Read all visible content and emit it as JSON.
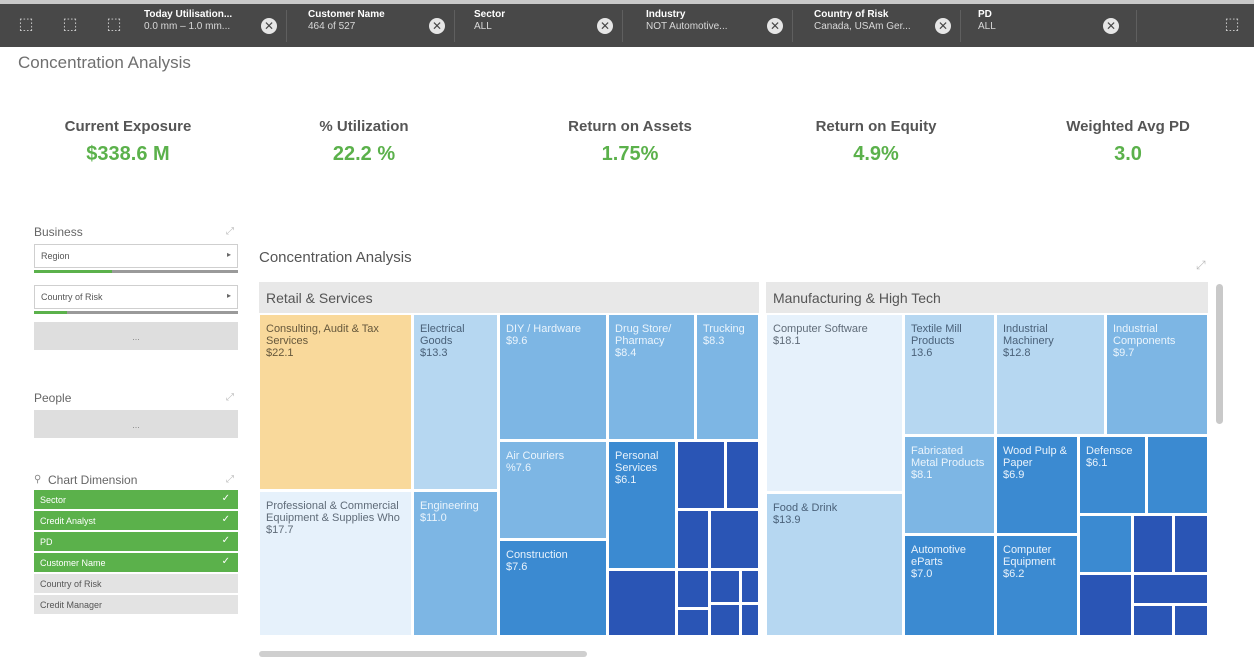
{
  "filters": [
    {
      "title": "Today Utilisation...",
      "value": "0.0 mm – 1.0 mm..."
    },
    {
      "title": "Customer Name",
      "value": "464 of 527"
    },
    {
      "title": "Sector",
      "value": "ALL"
    },
    {
      "title": "Industry",
      "value": "NOT Automotive..."
    },
    {
      "title": "Country of Risk",
      "value": "Canada, USAm Ger..."
    },
    {
      "title": "PD",
      "value": "ALL"
    }
  ],
  "app_title": "Concentration Analysis",
  "kpis": [
    {
      "label": "Current Exposure",
      "value": "$338.6 M"
    },
    {
      "label": "% Utilization",
      "value": "22.2 %"
    },
    {
      "label": "Return on Assets",
      "value": "1.75%"
    },
    {
      "label": "Return on Equity",
      "value": "4.9%"
    },
    {
      "label": "Weighted Avg PD",
      "value": "3.0"
    }
  ],
  "business": {
    "title": "Business",
    "items": [
      "Region",
      "Country of Risk"
    ],
    "more": "..."
  },
  "people": {
    "title": "People",
    "more": "..."
  },
  "chart_dimension": {
    "title": "Chart Dimension",
    "items": [
      {
        "label": "Sector",
        "selected": true
      },
      {
        "label": "Credit Analyst",
        "selected": true
      },
      {
        "label": "PD",
        "selected": true
      },
      {
        "label": "Customer Name",
        "selected": true
      },
      {
        "label": "Country of Risk",
        "selected": false
      },
      {
        "label": "Credit Manager",
        "selected": false
      }
    ]
  },
  "treemap": {
    "title": "Concentration Analysis",
    "groups": [
      {
        "name": "Retail & Services",
        "cells": [
          {
            "name": "Consulting, Audit & Tax Services",
            "value": "$22.1"
          },
          {
            "name": "Electrical Goods",
            "value": "$13.3"
          },
          {
            "name": "DIY / Hardware",
            "value": "$9.6"
          },
          {
            "name": "Drug Store/ Pharmacy",
            "value": "$8.4"
          },
          {
            "name": "Trucking",
            "value": "$8.3"
          },
          {
            "name": "Air Couriers",
            "value": "%7.6"
          },
          {
            "name": "Personal Services",
            "value": "$6.1"
          },
          {
            "name": "Professional & Commercial Equipment & Supplies Who",
            "value": "$17.7"
          },
          {
            "name": "Engineering",
            "value": "$11.0"
          },
          {
            "name": "Construction",
            "value": "$7.6"
          }
        ]
      },
      {
        "name": "Manufacturing & High Tech",
        "cells": [
          {
            "name": "Computer Software",
            "value": "$18.1"
          },
          {
            "name": "Textile Mill Products",
            "value": "13.6"
          },
          {
            "name": "Industrial Machinery",
            "value": "$12.8"
          },
          {
            "name": "Industrial Components",
            "value": "$9.7"
          },
          {
            "name": "Fabricated Metal Products",
            "value": "$8.1"
          },
          {
            "name": "Wood Pulp & Paper",
            "value": "$6.9"
          },
          {
            "name": "Defensce",
            "value": "$6.1"
          },
          {
            "name": "Food & Drink",
            "value": "$13.9"
          },
          {
            "name": "Automotive eParts",
            "value": "$7.0"
          },
          {
            "name": "Computer Equipment",
            "value": "$6.2"
          }
        ]
      }
    ]
  },
  "colors": {
    "accent": "#5bb14b",
    "selected": "#f9d99b",
    "toolbar": "#484848"
  }
}
